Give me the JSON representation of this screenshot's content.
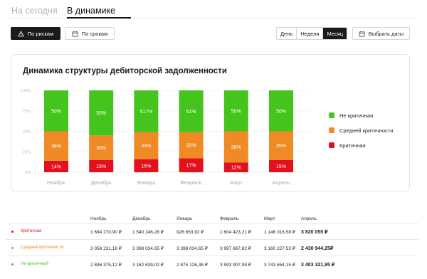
{
  "tabs": [
    {
      "label": "На сегодня",
      "active": false
    },
    {
      "label": "В динамике",
      "active": true
    }
  ],
  "toolbar": {
    "by_risk_label": "По рискам",
    "by_term_label": "По срокам",
    "periods": [
      "День",
      "Неделя",
      "Месяц"
    ],
    "active_period": "Месяц",
    "pick_dates_label": "Выбрать даты"
  },
  "chart_data": {
    "type": "bar",
    "stacked": true,
    "title": "Динамика структуры дебиторской задолженности",
    "categories": [
      "Ноябрь",
      "Декабрь",
      "Январь",
      "Февраль",
      "Март",
      "Апрель"
    ],
    "yticks": [
      "100%",
      "75%",
      "50%",
      "25%",
      "0%"
    ],
    "ylim": [
      0,
      100
    ],
    "grid": true,
    "legend_position": "right",
    "series": [
      {
        "name": "Критичная",
        "color": "#e3101e",
        "values": [
          14,
          15,
          16,
          17,
          12,
          15
        ],
        "labels": [
          "14%",
          "15%",
          "16%",
          "17%",
          "12%",
          "15%"
        ]
      },
      {
        "name": "Средней критичности",
        "color": "#f08a24",
        "values": [
          36,
          30,
          33,
          32,
          38,
          35
        ],
        "labels": [
          "36%",
          "30%",
          "33%",
          "32%",
          "38%",
          "35%"
        ]
      },
      {
        "name": "Не критичная",
        "color": "#45c41d",
        "values": [
          50,
          55,
          51,
          51,
          50,
          50
        ],
        "labels": [
          "50%",
          "55%",
          "517%",
          "51%",
          "50%",
          "50%"
        ]
      }
    ]
  },
  "legend": [
    {
      "label": "Не критичная",
      "color": "#45c41d"
    },
    {
      "label": "Средней критичности",
      "color": "#f08a24"
    },
    {
      "label": "Критичная",
      "color": "#e3101e"
    }
  ],
  "table": {
    "columns": [
      "Ноябрь",
      "Декабрь",
      "Январь",
      "Февраль",
      "Март",
      "Апрель"
    ],
    "rows": [
      {
        "label": "Критичная",
        "color": "#e3101e",
        "values": [
          "1 694 270,90 ₽",
          "1 540 246,28 ₽",
          "926 653,92 ₽",
          "1 604 423,21 ₽",
          "1 146 016,58 ₽",
          "3 820 055 ₽"
        ]
      },
      {
        "label": "Средней критичности",
        "color": "#f08a24",
        "values": [
          "3 058 231,18 ₽",
          "3 398 034,65 ₽",
          "3 398 034,65 ₽",
          "3 997 687,82 ₽",
          "3 160 227,53 ₽",
          "2 430 944,25₽"
        ]
      },
      {
        "label": "Не критичный",
        "color": "#45c41d",
        "values": [
          "2 846 375,12 ₽",
          "3 162 639,02 ₽",
          "2 875 126,38 ₽",
          "3 593 907,98 ₽",
          "3 743 654,15 ₽",
          "3 403 321,95 ₽"
        ]
      }
    ]
  }
}
